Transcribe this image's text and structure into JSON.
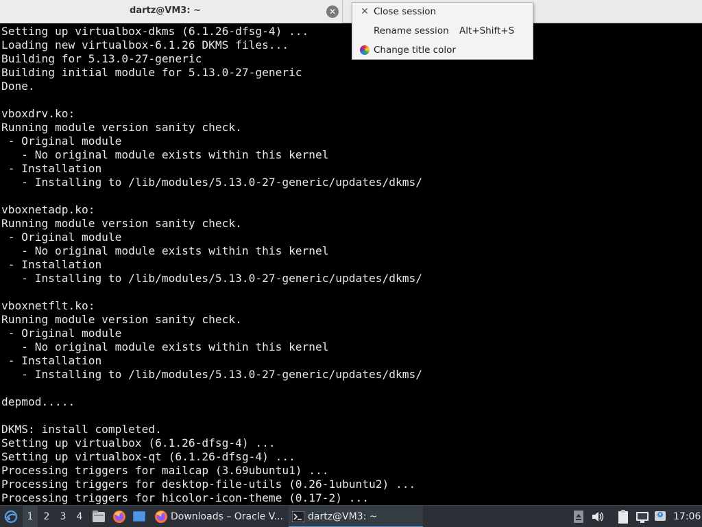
{
  "tab": {
    "title": "dartz@VM3: ~"
  },
  "context_menu": {
    "items": [
      {
        "label": "Close session",
        "shortcut": "",
        "icon": "close-icon"
      },
      {
        "label": "Rename session",
        "shortcut": "Alt+Shift+S",
        "icon": ""
      },
      {
        "label": "Change title color",
        "shortcut": "",
        "icon": "color-wheel-icon"
      }
    ]
  },
  "terminal": {
    "lines": [
      "Setting up virtualbox-dkms (6.1.26-dfsg-4) ...",
      "Loading new virtualbox-6.1.26 DKMS files...",
      "Building for 5.13.0-27-generic",
      "Building initial module for 5.13.0-27-generic",
      "Done.",
      "",
      "vboxdrv.ko:",
      "Running module version sanity check.",
      " - Original module",
      "   - No original module exists within this kernel",
      " - Installation",
      "   - Installing to /lib/modules/5.13.0-27-generic/updates/dkms/",
      "",
      "vboxnetadp.ko:",
      "Running module version sanity check.",
      " - Original module",
      "   - No original module exists within this kernel",
      " - Installation",
      "   - Installing to /lib/modules/5.13.0-27-generic/updates/dkms/",
      "",
      "vboxnetflt.ko:",
      "Running module version sanity check.",
      " - Original module",
      "   - No original module exists within this kernel",
      " - Installation",
      "   - Installing to /lib/modules/5.13.0-27-generic/updates/dkms/",
      "",
      "depmod.....",
      "",
      "DKMS: install completed.",
      "Setting up virtualbox (6.1.26-dfsg-4) ...",
      "Setting up virtualbox-qt (6.1.26-dfsg-4) ...",
      "Processing triggers for mailcap (3.69ubuntu1) ...",
      "Processing triggers for desktop-file-utils (0.26-1ubuntu2) ...",
      "Processing triggers for hicolor-icon-theme (0.17-2) ..."
    ]
  },
  "taskbar": {
    "workspaces": [
      "1",
      "2",
      "3",
      "4"
    ],
    "active_workspace": "1",
    "tasks": [
      {
        "label": "Downloads – Oracle V...",
        "icon": "firefox-icon"
      },
      {
        "label": "dartz@VM3: ~",
        "icon": "terminal-icon"
      }
    ],
    "clock": "17:06"
  },
  "colors": {
    "terminal_bg": "#000000",
    "terminal_fg": "#e8e8e8",
    "taskbar_bg": "#2b3036",
    "menu_bg": "#f3f3f3",
    "accent": "#4a9ee8"
  }
}
